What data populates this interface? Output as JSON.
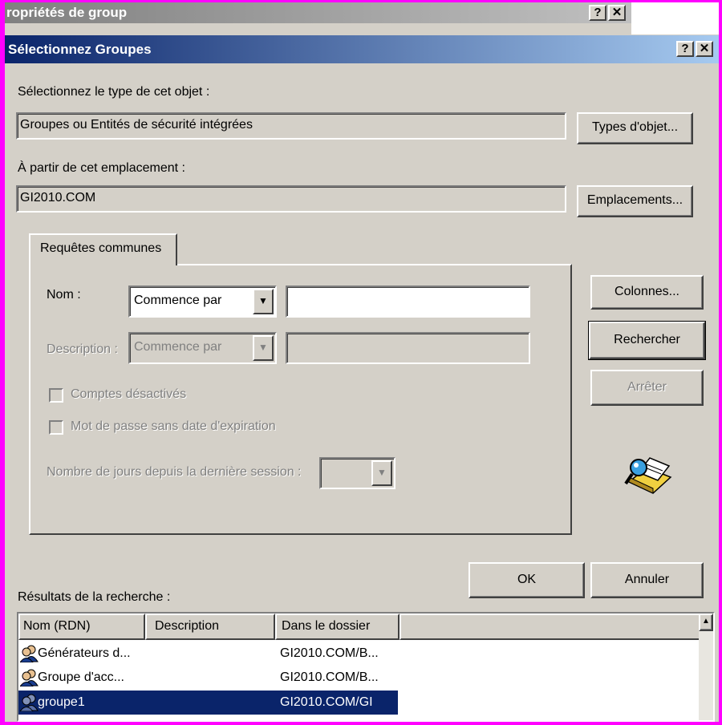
{
  "background_window": {
    "title": "ropriétés de group"
  },
  "title_bar": {
    "title": "Sélectionnez Groupes",
    "help": "?",
    "close": "X"
  },
  "object_type": {
    "label": "Sélectionnez le type de cet objet :",
    "value": "Groupes ou Entités de sécurité intégrées",
    "button": "Types d'objet..."
  },
  "location": {
    "label": "À partir de cet emplacement :",
    "value": "GI2010.COM",
    "button": "Emplacements..."
  },
  "tab": {
    "label": "Requêtes communes"
  },
  "query": {
    "name_label": "Nom :",
    "name_mode": "Commence par",
    "name_value": "",
    "desc_label": "Description :",
    "desc_mode": "Commence par",
    "desc_value": "",
    "disabled_accounts": "Comptes désactivés",
    "no_expire_password": "Mot de passe sans date d'expiration",
    "days_label": "Nombre de jours depuis la dernière session :",
    "days_value": ""
  },
  "side_buttons": {
    "columns": "Colonnes...",
    "search": "Rechercher",
    "stop": "Arrêter"
  },
  "dialog_buttons": {
    "ok": "OK",
    "cancel": "Annuler"
  },
  "results": {
    "label": "Résultats de la recherche :",
    "columns": [
      "Nom (RDN)",
      "Description",
      "Dans le dossier"
    ],
    "rows": [
      {
        "name": "Générateurs d...",
        "description": "",
        "folder": "GI2010.COM/B..."
      },
      {
        "name": "Groupe d'acc...",
        "description": "",
        "folder": "GI2010.COM/B..."
      },
      {
        "name": "groupe1",
        "description": "",
        "folder": "GI2010.COM/GI",
        "selected": true
      }
    ]
  },
  "colors": {
    "title_active": "#0a246a",
    "face": "#d4d0c8",
    "selection": "#0a246a",
    "border_outer": "#ff00ff"
  },
  "icons": [
    "help-icon",
    "close-icon",
    "dropdown-arrow-icon",
    "search-directory-icon",
    "group-icon",
    "scroll-up-icon"
  ]
}
